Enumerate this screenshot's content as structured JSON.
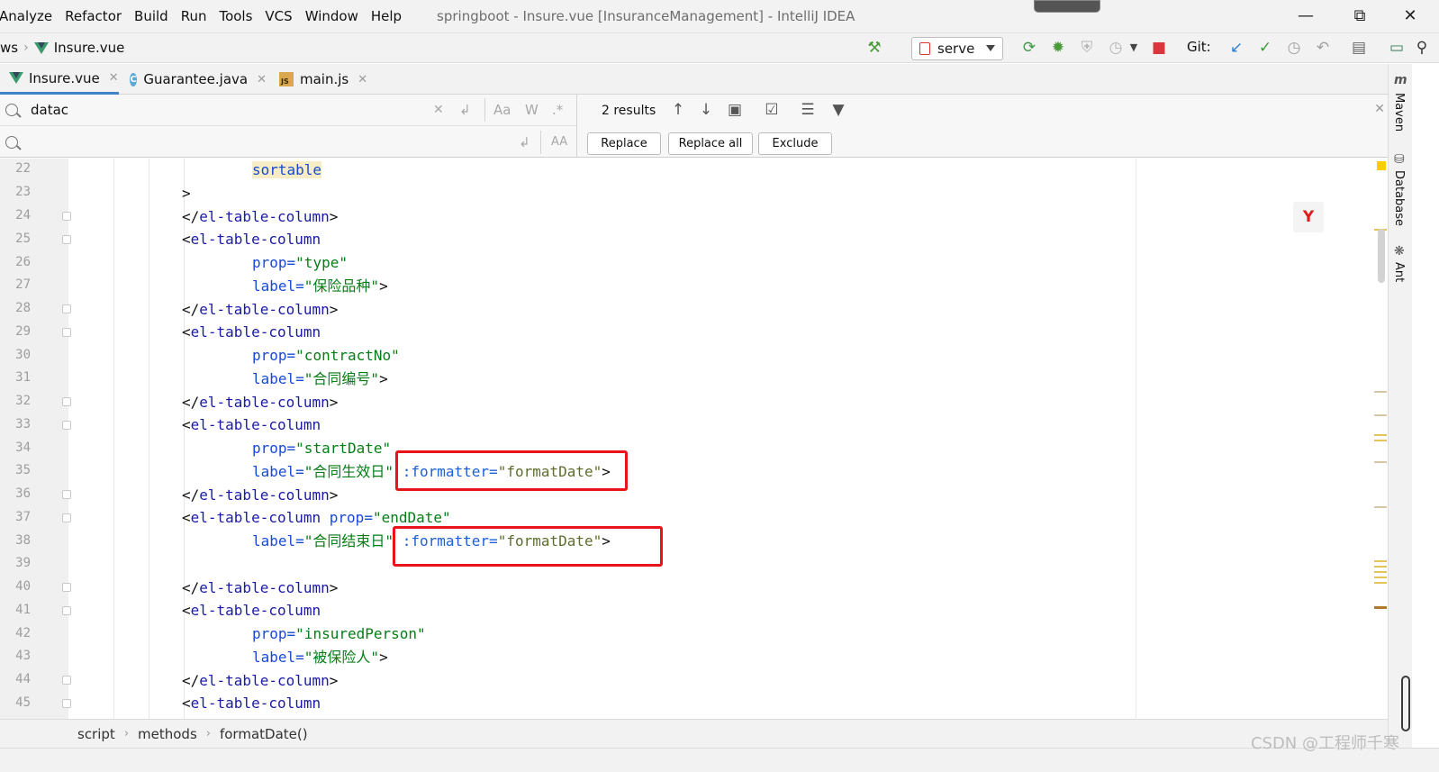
{
  "menu": {
    "items": [
      "Analyze",
      "Refactor",
      "Build",
      "Run",
      "Tools",
      "VCS",
      "Window",
      "Help"
    ],
    "window_title": "springboot - Insure.vue [InsuranceManagement] - IntelliJ IDEA"
  },
  "nav": {
    "crumb_prev": "ws",
    "crumb_file": "Insure.vue",
    "run_config": "serve",
    "git_label": "Git:"
  },
  "tabs": [
    {
      "label": "Insure.vue",
      "icon": "vue-icon",
      "active": true
    },
    {
      "label": "Guarantee.java",
      "icon": "java-class-icon",
      "active": false
    },
    {
      "label": "main.js",
      "icon": "js-file-icon",
      "active": false
    }
  ],
  "find": {
    "query": "datac",
    "replace_value": "",
    "opt_case": "Aa",
    "opt_words": "W",
    "opt_regex": ".*",
    "opt_preserve_case": "AA",
    "results": "2 results",
    "replace_btn": "Replace",
    "replace_all_btn": "Replace all",
    "exclude_btn": "Exclude"
  },
  "editor": {
    "line_numbers": [
      "22",
      "23",
      "24",
      "25",
      "26",
      "27",
      "28",
      "29",
      "30",
      "31",
      "32",
      "33",
      "34",
      "35",
      "36",
      "37",
      "38",
      "39",
      "40",
      "41",
      "42",
      "43",
      "44",
      "45"
    ],
    "code": {
      "l22": "sortable",
      "l23": ">",
      "l24_open": "</",
      "l24_tag": "el-table-column",
      "l24_close": ">",
      "l25_open": "<",
      "l25_tag": "el-table-column",
      "l26_attr": "prop=",
      "l26_val": "\"type\"",
      "l27_attr": "label=",
      "l27_val": "\"保险品种\"",
      "l27_close": ">",
      "l28_open": "</",
      "l28_tag": "el-table-column",
      "l28_close": ">",
      "l29_open": "<",
      "l29_tag": "el-table-column",
      "l30_attr": "prop=",
      "l30_val": "\"contractNo\"",
      "l31_attr": "label=",
      "l31_val": "\"合同编号\"",
      "l31_close": ">",
      "l32_open": "</",
      "l32_tag": "el-table-column",
      "l32_close": ">",
      "l33_open": "<",
      "l33_tag": "el-table-column",
      "l34_attr": "prop=",
      "l34_val": "\"startDate\"",
      "l35_attr": "label=",
      "l35_val": "\"合同生效日\"",
      "l35_bind": ":formatter=",
      "l35_bindval": "\"formatDate\"",
      "l35_close": ">",
      "l36_open": "</",
      "l36_tag": "el-table-column",
      "l36_close": ">",
      "l37_open": "<",
      "l37_tag": "el-table-column",
      "l37_attr": "prop=",
      "l37_val": "\"endDate\"",
      "l38_attr": "label=",
      "l38_val": "\"合同结束日\"",
      "l38_bind": ":formatter=",
      "l38_bindval": "\"formatDate\"",
      "l38_close": ">",
      "l40_open": "</",
      "l40_tag": "el-table-column",
      "l40_close": ">",
      "l41_open": "<",
      "l41_tag": "el-table-column",
      "l42_attr": "prop=",
      "l42_val": "\"insuredPerson\"",
      "l43_attr": "label=",
      "l43_val": "\"被保险人\"",
      "l43_close": ">",
      "l44_open": "</",
      "l44_tag": "el-table-column",
      "l44_close": ">",
      "l45_open": "<",
      "l45_tag": "el-table-column"
    },
    "inspection_badge": "Y"
  },
  "tool_windows": [
    "Maven",
    "Database",
    "Ant"
  ],
  "breadcrumb": [
    "script",
    "methods",
    "formatDate()"
  ],
  "watermark": "CSDN @工程师千寒",
  "colors": {
    "accent_tab": "#4083c9",
    "highlight_box": "#e8131b",
    "tag": "#1a1aa6",
    "string": "#067d17",
    "attribute": "#174ad4"
  }
}
